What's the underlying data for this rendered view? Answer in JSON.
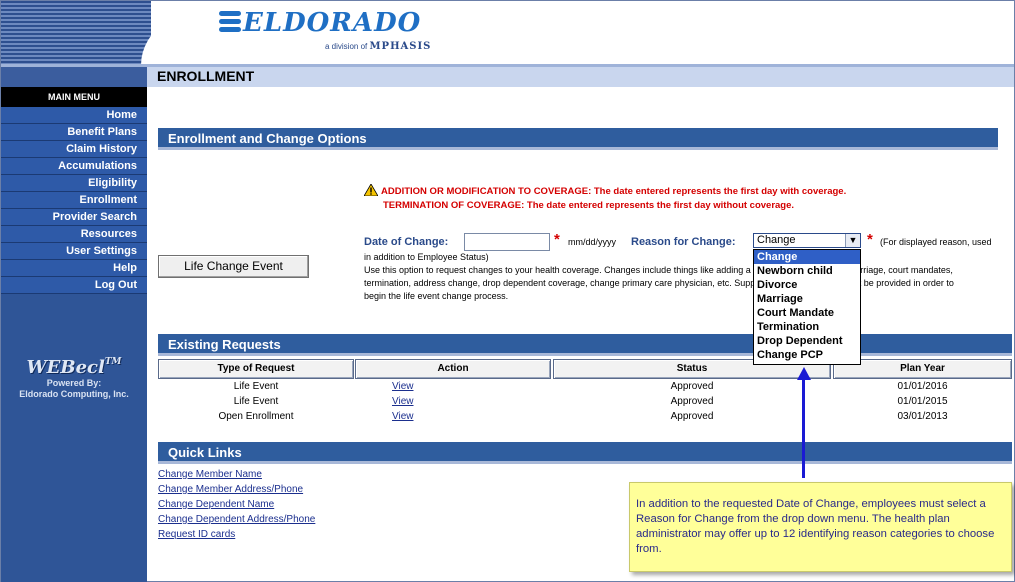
{
  "header": {
    "logo_text": "ELDORADO",
    "logo_sub_prefix": "a division of",
    "logo_sub_brand": "MPHASIS"
  },
  "page_title": "ENROLLMENT",
  "sidebar": {
    "heading": "MAIN MENU",
    "items": [
      {
        "label": "Home"
      },
      {
        "label": "Benefit Plans"
      },
      {
        "label": "Claim History"
      },
      {
        "label": "Accumulations"
      },
      {
        "label": "Eligibility"
      },
      {
        "label": "Enrollment"
      },
      {
        "label": "Provider Search"
      },
      {
        "label": "Resources"
      },
      {
        "label": "User Settings"
      },
      {
        "label": "Help"
      },
      {
        "label": "Log Out"
      }
    ],
    "webcel_logo": "WEBecl",
    "webcel_tm": "TM",
    "powered_by": "Powered By:",
    "powered_company": "Eldorado Computing, Inc."
  },
  "options_section": {
    "title": "Enrollment and Change Options",
    "warning_line1": "ADDITION OR MODIFICATION TO COVERAGE:  The date entered represents the first day with coverage.",
    "warning_line2": "TERMINATION OF COVERAGE:  The date entered represents the first day without coverage.",
    "date_label": "Date of Change:",
    "date_value": "",
    "date_format": "mm/dd/yyyy",
    "reason_label": "Reason for Change:",
    "reason_selected": "Change",
    "reason_note": "(For displayed reason, used",
    "reason_note2": "in addition to Employee Status)",
    "description_lines": [
      "Use this option to request changes to your health coverage. Changes include things like adding a newborn child, divorce, marriage, court mandates,",
      "termination, address change, drop dependent coverage, change primary care physician, etc. Supporting documentation must be provided in order to",
      "begin the life event change process."
    ],
    "reason_options": [
      "Change",
      "Newborn child",
      "Divorce",
      "Marriage",
      "Court Mandate",
      "Termination",
      "Drop Dependent",
      "Change PCP"
    ],
    "life_change_button": "Life Change Event"
  },
  "existing_requests": {
    "title": "Existing Requests",
    "columns": [
      "Type of Request",
      "Action",
      "Status",
      "Plan Year"
    ],
    "rows": [
      {
        "type": "Life Event",
        "action": "View",
        "status": "Approved",
        "plan_year": "01/01/2016"
      },
      {
        "type": "Life Event",
        "action": "View",
        "status": "Approved",
        "plan_year": "01/01/2015"
      },
      {
        "type": "Open Enrollment",
        "action": "View",
        "status": "Approved",
        "plan_year": "03/01/2013"
      }
    ]
  },
  "quick_links": {
    "title": "Quick Links",
    "links": [
      "Change Member Name",
      "Change Member Address/Phone",
      "Change Dependent Name",
      "Change Dependent Address/Phone",
      "Request ID cards"
    ]
  },
  "callout": {
    "text": "In addition to the requested Date of Change, employees must select a Reason for Change from the drop down menu.  The health plan administrator may offer up to 12 identifying reason categories to choose from."
  },
  "colors": {
    "nav_blue": "#2e5aa8",
    "bar_blue": "#2f5d9e",
    "warning_red": "#d40000",
    "callout_yellow": "#ffff99",
    "arrow_blue": "#1a1ad4"
  }
}
